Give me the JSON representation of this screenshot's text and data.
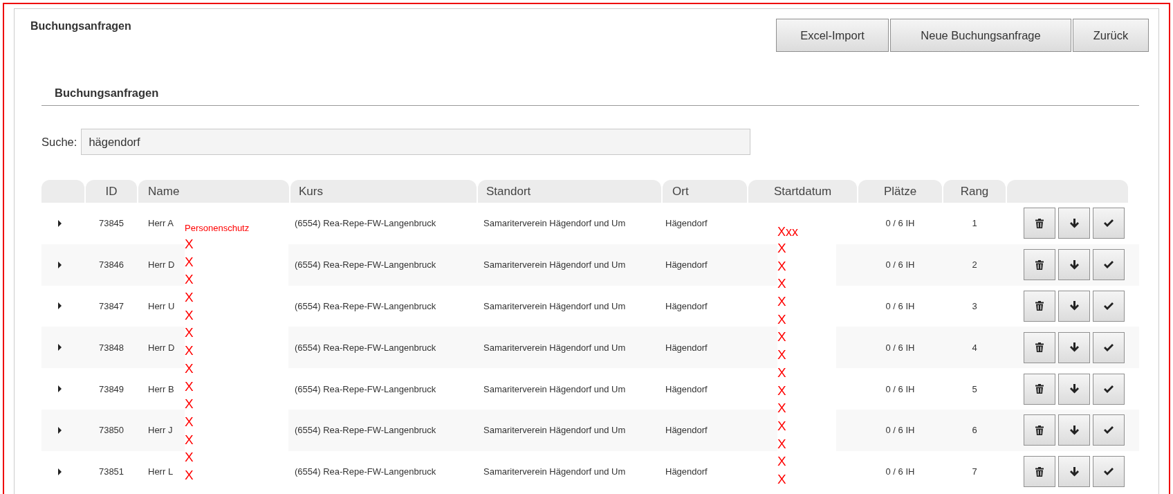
{
  "page": {
    "title": "Buchungsanfragen",
    "buttons": [
      "Excel-Import",
      "Neue Buchungsanfrage",
      "Zurück"
    ]
  },
  "section": {
    "heading": "Buchungsanfragen"
  },
  "search": {
    "label": "Suche:",
    "value": "hägendorf"
  },
  "table": {
    "columns": [
      "ID",
      "Name",
      "Kurs",
      "Standort",
      "Ort",
      "Startdatum",
      "Plätze",
      "Rang"
    ],
    "rows": [
      {
        "id": "73845",
        "name": "Herr A",
        "kurs": "(6554) Rea-Repe-FW-Langenbruck",
        "standort": "Samariterverein Hägendorf und Um",
        "ort": "Hägendorf",
        "plaetze": "0 / 6 IH",
        "rang": "1"
      },
      {
        "id": "73846",
        "name": "Herr D",
        "kurs": "(6554) Rea-Repe-FW-Langenbruck",
        "standort": "Samariterverein Hägendorf und Um",
        "ort": "Hägendorf",
        "plaetze": "0 / 6 IH",
        "rang": "2"
      },
      {
        "id": "73847",
        "name": "Herr U",
        "kurs": "(6554) Rea-Repe-FW-Langenbruck",
        "standort": "Samariterverein Hägendorf und Um",
        "ort": "Hägendorf",
        "plaetze": "0 / 6 IH",
        "rang": "3"
      },
      {
        "id": "73848",
        "name": "Herr D",
        "kurs": "(6554) Rea-Repe-FW-Langenbruck",
        "standort": "Samariterverein Hägendorf und Um",
        "ort": "Hägendorf",
        "plaetze": "0 / 6 IH",
        "rang": "4"
      },
      {
        "id": "73849",
        "name": "Herr B",
        "kurs": "(6554) Rea-Repe-FW-Langenbruck",
        "standort": "Samariterverein Hägendorf und Um",
        "ort": "Hägendorf",
        "plaetze": "0 / 6 IH",
        "rang": "5"
      },
      {
        "id": "73850",
        "name": "Herr J",
        "kurs": "(6554) Rea-Repe-FW-Langenbruck",
        "standort": "Samariterverein Hägendorf und Um",
        "ort": "Hägendorf",
        "plaetze": "0 / 6 IH",
        "rang": "6"
      },
      {
        "id": "73851",
        "name": "Herr L",
        "kurs": "(6554) Rea-Repe-FW-Langenbruck",
        "standort": "Samariterverein Hägendorf und Um",
        "ort": "Hägendorf",
        "plaetze": "0 / 6 IH",
        "rang": "7"
      }
    ]
  },
  "redactions": [
    {
      "label": "Personenschutz",
      "marks": [
        "X",
        "X",
        "X",
        "X",
        "X",
        "X",
        "X",
        "X",
        "X",
        "X",
        "X",
        "X",
        "X",
        "X"
      ]
    },
    {
      "label": "Xxx",
      "marks": [
        "X",
        "X",
        "X",
        "X",
        "X",
        "X",
        "X",
        "X",
        "X",
        "X",
        "X",
        "X",
        "X",
        "X"
      ]
    }
  ]
}
